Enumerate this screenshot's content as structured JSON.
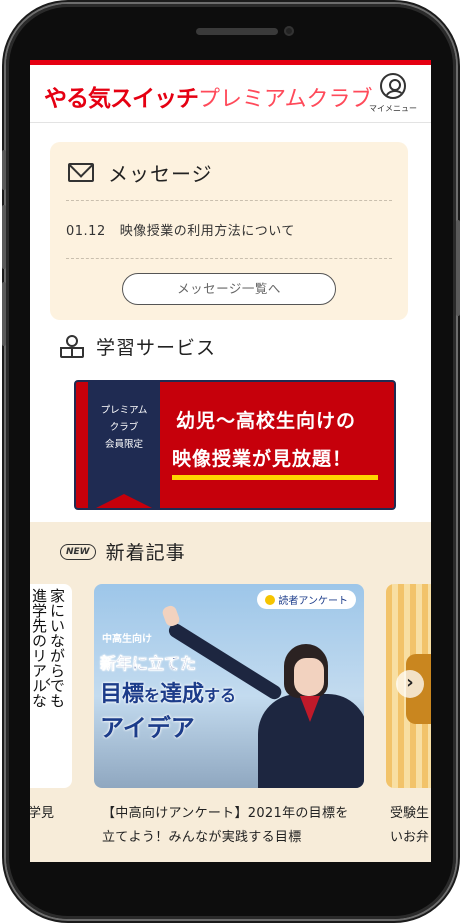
{
  "header": {
    "brand_bold": "やる気スイッチ",
    "brand_light": "プレミアムクラブ",
    "mymenu_label": "マイメニュー"
  },
  "messages": {
    "title": "メッセージ",
    "items": [
      {
        "date": "01.12",
        "text": "映像授業の利用方法について"
      }
    ],
    "more_button": "メッセージ一覧へ"
  },
  "study_service": {
    "title": "学習サービス",
    "banner": {
      "ribbon_lines": [
        "プレミアム",
        "クラブ",
        "会員限定"
      ],
      "line1": "幼児〜高校生向けの",
      "line2": "映像授業が見放題！"
    }
  },
  "news": {
    "badge": "NEW",
    "title": "新着記事",
    "left_card": {
      "vertical_text": [
        "家にいながらでも",
        "進学先のリアルな"
      ],
      "caption": "学見"
    },
    "main_card": {
      "badge": "読者アンケート",
      "subtitle": "中高生向け",
      "line1": "新年に立てた",
      "line2a": "目標",
      "line2b": "を",
      "line2c": "達成",
      "line2d": "する",
      "line3": "アイデア",
      "caption": "【中高向けアンケート】2021年の目標を立てよう！みんなが実践する目標"
    },
    "right_card": {
      "caption_lines": [
        "受験生",
        "いお弁"
      ]
    }
  },
  "colors": {
    "brand_red": "#e50012",
    "banner_red": "#c6000b",
    "navy": "#1f2b52",
    "highlight_yellow": "#ffd400",
    "message_bg": "#fdf2df",
    "news_bg": "#f7ecd9"
  }
}
